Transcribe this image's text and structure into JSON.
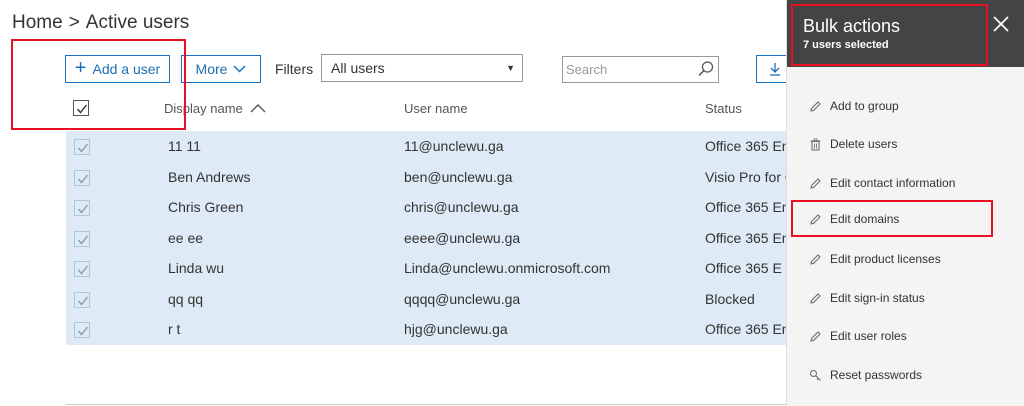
{
  "breadcrumb": {
    "home": "Home",
    "separator": ">",
    "current": "Active users"
  },
  "toolbar": {
    "add_user_label": "Add a user",
    "more_label": "More",
    "filters_label": "Filters",
    "filter_value": "All users",
    "search_placeholder": "Search"
  },
  "table": {
    "columns": {
      "display_name": "Display name",
      "user_name": "User name",
      "status": "Status"
    },
    "rows": [
      {
        "name": "11 11",
        "user": "11@unclewu.ga",
        "status": "Office 365 En"
      },
      {
        "name": "Ben Andrews",
        "user": "ben@unclewu.ga",
        "status": "Visio Pro for O"
      },
      {
        "name": "Chris Green",
        "user": "chris@unclewu.ga",
        "status": "Office 365 En"
      },
      {
        "name": "ee ee",
        "user": "eeee@unclewu.ga",
        "status": "Office 365 En"
      },
      {
        "name": "Linda wu",
        "user": "Linda@unclewu.onmicrosoft.com",
        "status": "Office 365 E"
      },
      {
        "name": "qq qq",
        "user": "qqqq@unclewu.ga",
        "status": "Blocked"
      },
      {
        "name": "r t",
        "user": "hjg@unclewu.ga",
        "status": "Office 365 En"
      }
    ]
  },
  "panel": {
    "title": "Bulk actions",
    "subtitle": "7 users selected",
    "actions": [
      {
        "label": "Add to group",
        "icon": "pencil-icon"
      },
      {
        "label": "Delete users",
        "icon": "trash-icon"
      },
      {
        "label": "Edit contact information",
        "icon": "pencil-icon"
      },
      {
        "label": "Edit domains",
        "icon": "pencil-icon"
      },
      {
        "label": "Edit product licenses",
        "icon": "pencil-icon"
      },
      {
        "label": "Edit sign-in status",
        "icon": "pencil-icon"
      },
      {
        "label": "Edit user roles",
        "icon": "pencil-icon"
      },
      {
        "label": "Reset passwords",
        "icon": "key-icon"
      }
    ]
  },
  "colors": {
    "accent": "#1a73c8",
    "selected_row_bg": "#deeaf5",
    "panel_header_bg": "#444444",
    "annotation_red": "#e81123"
  }
}
